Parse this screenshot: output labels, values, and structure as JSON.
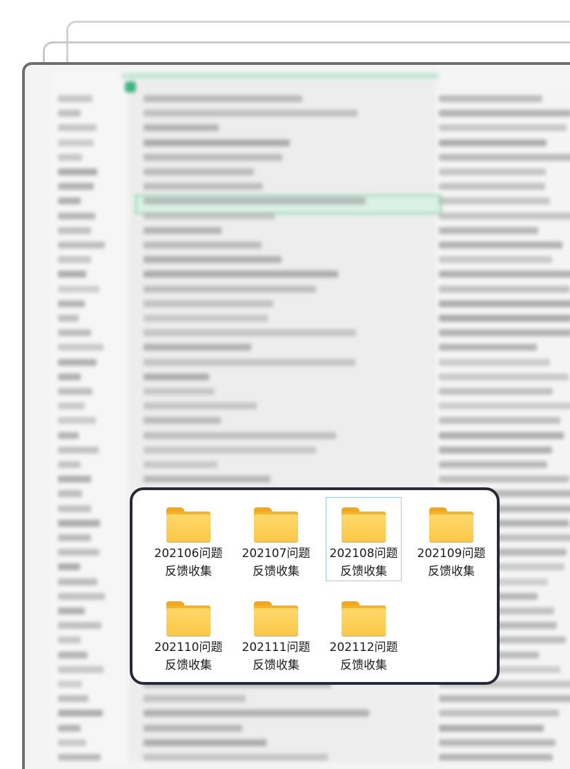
{
  "folders": [
    {
      "label": "202106问题反馈收集",
      "selected": false
    },
    {
      "label": "202107问题反馈收集",
      "selected": false
    },
    {
      "label": "202108问题反馈收集",
      "selected": true
    },
    {
      "label": "202109问题反馈收集",
      "selected": false
    },
    {
      "label": "202110问题反馈收集",
      "selected": false
    },
    {
      "label": "202111问题反馈收集",
      "selected": false
    },
    {
      "label": "202112问题反馈收集",
      "selected": false
    }
  ],
  "colors": {
    "panel_border": "#262838",
    "folder_yellow": "#fbc846",
    "selection_border": "#9ccdf0",
    "sheet_accent": "#35b27c"
  },
  "icons": {
    "folder": "folder-icon"
  }
}
